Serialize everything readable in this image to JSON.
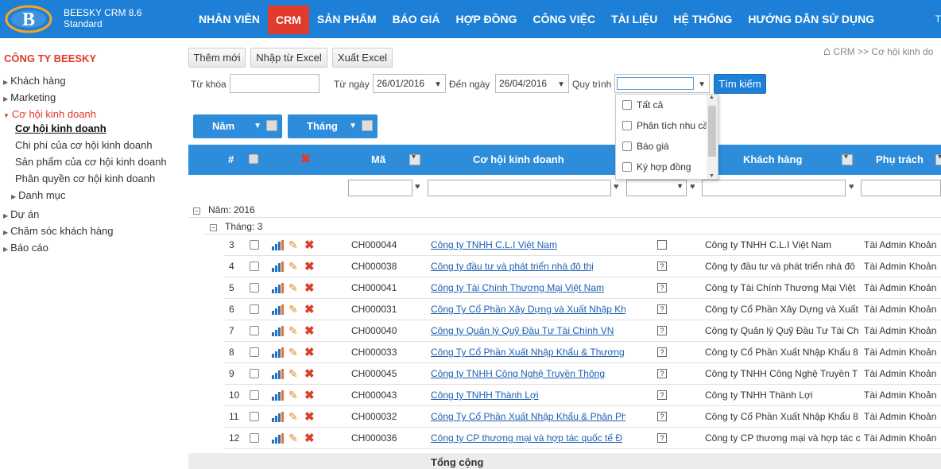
{
  "colors": {
    "accent": "#1e7fd6",
    "header": "#2d8ddb",
    "danger": "#e03b2b",
    "link": "#1a5fb4"
  },
  "app": {
    "name": "BEESKY CRM 8.6",
    "edition": "Standard",
    "top_right": "T"
  },
  "nav": [
    "NHÂN VIÊN",
    "CRM",
    "SẢN PHẨM",
    "BÁO GIÁ",
    "HỢP ĐỒNG",
    "CÔNG VIỆC",
    "TÀI LIỆU",
    "HỆ THỐNG",
    "HƯỚNG DẪN SỬ DỤNG"
  ],
  "nav_active": "CRM",
  "sidebar": {
    "company": "CÔNG TY BEESKY",
    "items": [
      {
        "label": "Khách hàng"
      },
      {
        "label": "Marketing"
      },
      {
        "label": "Cơ hội kinh doanh"
      },
      {
        "label": "Cơ hội kinh doanh"
      },
      {
        "label": "Chi phí của cơ hội kinh doanh"
      },
      {
        "label": "Sản phẩm của cơ hội kinh doanh"
      },
      {
        "label": "Phân quyền cơ hội kinh doanh"
      },
      {
        "label": "Danh mục"
      },
      {
        "label": "Dự án"
      },
      {
        "label": "Chăm sóc khách hàng"
      },
      {
        "label": "Báo cáo"
      }
    ]
  },
  "toolbar": {
    "add": "Thêm mới",
    "import": "Nhập từ Excel",
    "export": "Xuất Excel"
  },
  "breadcrumb": "CRM >> Cơ hội kinh do",
  "search": {
    "keyword_label": "Từ khóa",
    "keyword_value": "",
    "from_label": "Từ ngày",
    "from_value": "26/01/2016",
    "to_label": "Đến ngày",
    "to_value": "26/04/2016",
    "process_label": "Quy trình",
    "process_value": "",
    "button": "Tìm kiếm"
  },
  "process_options": [
    "Tất cả",
    "Phân tích nhu cầ",
    "Báo giá",
    "Ký hợp đồng"
  ],
  "groupby": {
    "year": "Năm",
    "month": "Tháng"
  },
  "columns": {
    "index": "#",
    "code": "Mã",
    "opportunity": "Cơ hội kinh doanh",
    "customer": "Khách hàng",
    "owner": "Phụ trách"
  },
  "groups": {
    "year": "Năm: 2016",
    "month": "Tháng: 3"
  },
  "rows": [
    {
      "no": "3",
      "code": "CH000044",
      "name": "Công ty TNHH C.L.I Việt Nam",
      "customer": "Công ty TNHH C.L.I Việt Nam",
      "owner": "Tài Admin Khoản",
      "flag": ""
    },
    {
      "no": "4",
      "code": "CH000038",
      "name": "Công ty đầu tư và phát triển nhà đô thị",
      "customer": "Công ty đầu tư và phát triển nhà đô",
      "owner": "Tài Admin Khoản",
      "flag": "?"
    },
    {
      "no": "5",
      "code": "CH000041",
      "name": "Công ty Tài Chính Thương Mại Việt Nam",
      "customer": "Công ty Tài Chính Thương Mại Việt",
      "owner": "Tài Admin Khoản",
      "flag": "?"
    },
    {
      "no": "6",
      "code": "CH000031",
      "name": "Công Ty Cổ Phần Xây Dựng và Xuất Nhập Kh",
      "customer": "Công ty Cổ Phần Xây Dựng và Xuất",
      "owner": "Tài Admin Khoản",
      "flag": "?"
    },
    {
      "no": "7",
      "code": "CH000040",
      "name": "Công ty Quản lý Quỹ Đầu Tư Tài Chính VN",
      "customer": "Công ty Quản lý Quỹ Đầu Tư Tài Ch",
      "owner": "Tài Admin Khoản",
      "flag": "?"
    },
    {
      "no": "8",
      "code": "CH000033",
      "name": "Công Ty Cổ Phần Xuất Nhập Khẩu & Thương",
      "customer": "Công ty Cổ Phần Xuất Nhập Khẩu 8",
      "owner": "Tài Admin Khoản",
      "flag": "?"
    },
    {
      "no": "9",
      "code": "CH000045",
      "name": "Công ty TNHH Công Nghệ Truyền Thông",
      "customer": "Công ty TNHH Công Nghệ Truyền T",
      "owner": "Tài Admin Khoản",
      "flag": "?"
    },
    {
      "no": "10",
      "code": "CH000043",
      "name": "Công ty TNHH Thành Lợi",
      "customer": "Công ty TNHH Thành Lợi",
      "owner": "Tài Admin Khoản",
      "flag": "?"
    },
    {
      "no": "11",
      "code": "CH000032",
      "name": "Công Ty Cổ Phần Xuất Nhập Khẩu & Phân Ph",
      "customer": "Công ty Cổ Phần Xuất Nhập Khẩu 8",
      "owner": "Tài Admin Khoản",
      "flag": "?"
    },
    {
      "no": "12",
      "code": "CH000036",
      "name": "Công ty CP thương mại và hợp tác quốc tế Đ",
      "customer": "Công ty CP thương mại và hợp tác c",
      "owner": "Tài Admin Khoản",
      "flag": "?"
    }
  ],
  "footer": {
    "total": "Tổng cộng"
  }
}
